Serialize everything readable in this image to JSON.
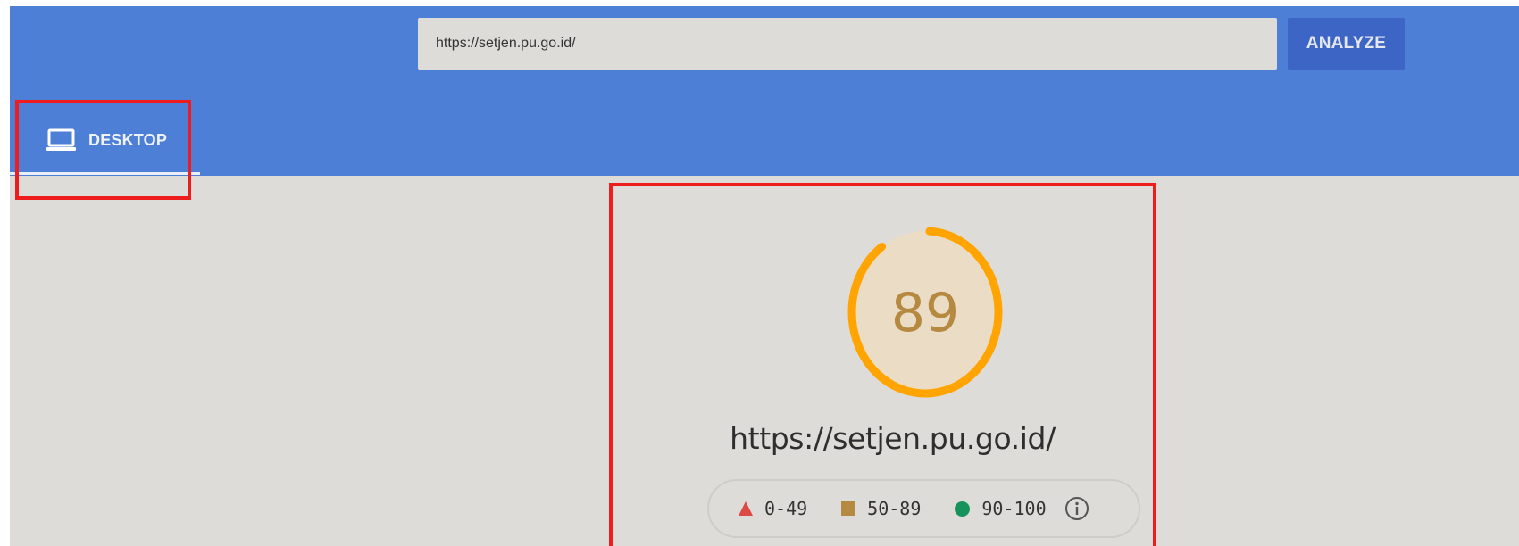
{
  "search": {
    "url_value": "https://setjen.pu.go.id/",
    "analyze_label": "ANALYZE"
  },
  "tabs": [
    {
      "label": "DESKTOP",
      "icon": "laptop-icon",
      "selected": true
    }
  ],
  "report": {
    "score": "89",
    "score_fraction": 0.89,
    "url": "https://setjen.pu.go.id/",
    "legend": [
      {
        "range": "0-49",
        "icon": "triangle-fail-icon",
        "color": "#db4a44"
      },
      {
        "range": "50-89",
        "icon": "square-average-icon",
        "color": "#b5893f"
      },
      {
        "range": "90-100",
        "icon": "circle-pass-icon",
        "color": "#16925b"
      }
    ],
    "info_icon": "info-icon"
  },
  "colors": {
    "header": "#4e7fd6",
    "analyze_button": "#3c65c5",
    "background": "#dedcd9",
    "gauge_arc": "#ffa400",
    "gauge_fill": "#ebdcc5",
    "score_text": "#b5893f",
    "highlight": "#ee1c1c"
  }
}
